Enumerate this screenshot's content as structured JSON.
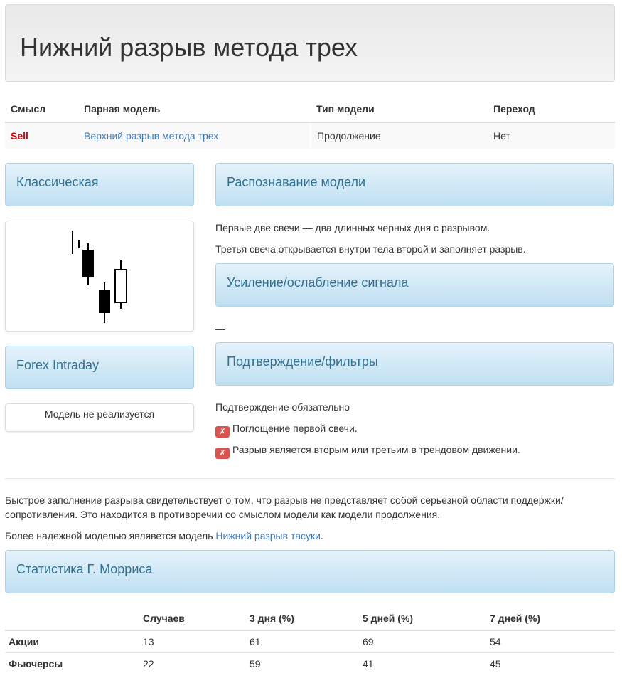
{
  "page": {
    "title": "Нижний разрыв метода трех"
  },
  "info_table": {
    "headers": [
      "Смысл",
      "Парная модель",
      "Тип модели",
      "Переход"
    ],
    "row": {
      "meaning": "Sell",
      "paired_model": "Верхний разрыв метода трех",
      "model_type": "Продолжение",
      "transition": "Нет"
    }
  },
  "left": {
    "classic_heading": "Классическая",
    "forex_heading": "Forex Intraday",
    "forex_note": "Модель не реализуется"
  },
  "right": {
    "recognition_heading": "Распознавание модели",
    "recognition_lines": [
      "Первые две свечи — два длинных черных дня с разрывом.",
      "Третья свеча открывается внутри тела второй и заполняет разрыв."
    ],
    "signal_heading": "Усиление/ослабление сигнала",
    "signal_text": "—",
    "confirm_heading": "Подтверждение/фильтры",
    "confirm_text": "Подтверждение обязательно",
    "filters": [
      "Поглощение первой свечи.",
      "Разрыв является вторым или третьим в трендовом движении."
    ],
    "filter_icon": "✗"
  },
  "bottom": {
    "para1": "Быстрое заполнение разрыва свидетельствует о том, что разрыв не представляет собой серьезной области поддержки/ сопротивления. Это находится в противоречии со смыслом модели как модели продолжения.",
    "para2_prefix": "Более надежной моделью являвется модель ",
    "para2_link": "Нижний разрыв тасуки",
    "para2_suffix": "."
  },
  "stats": {
    "heading": "Статистика Г. Морриса",
    "headers": [
      "",
      "Случаев",
      "3 дня (%)",
      "5 дней (%)",
      "7 дней (%)"
    ],
    "rows": [
      [
        "Акции",
        "13",
        "61",
        "69",
        "54"
      ],
      [
        "Фьючерсы",
        "22",
        "59",
        "41",
        "45"
      ]
    ]
  },
  "colors": {
    "sell": "#d9000d",
    "link": "#3a7bbf",
    "panel_text": "#31708f",
    "x_icon_bg": "#d9534f"
  }
}
